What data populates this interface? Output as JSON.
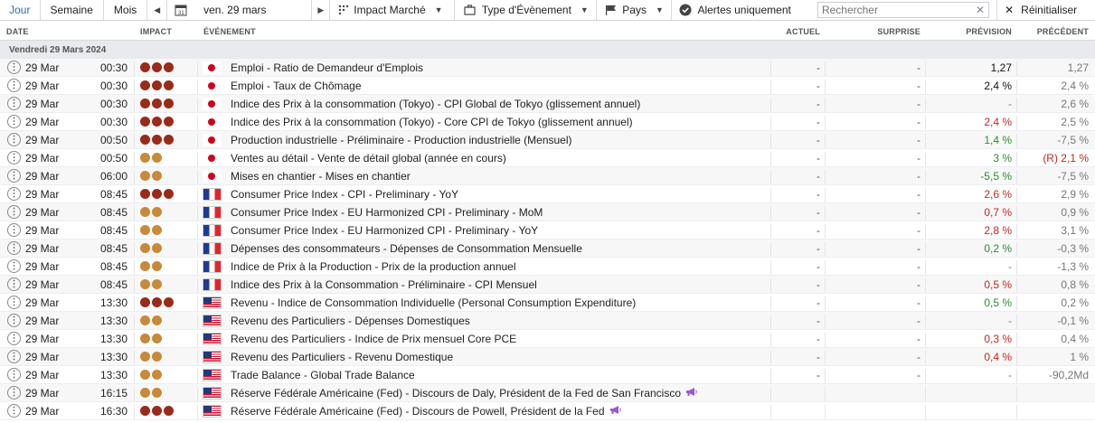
{
  "toolbar": {
    "tabs": [
      "Jour",
      "Semaine",
      "Mois"
    ],
    "date": "ven. 29 mars",
    "impact_filter": "Impact Marché",
    "type_filter": "Type d'Évènement",
    "country_filter": "Pays",
    "alerts_label": "Alertes uniquement",
    "search_placeholder": "Rechercher",
    "reset_label": "Réinitialiser"
  },
  "columns": {
    "date": "DATE",
    "impact": "IMPACT",
    "event": "ÉVÉNEMENT",
    "actual": "ACTUEL",
    "surprise": "SURPRISE",
    "forecast": "PRÉVISION",
    "previous": "PRÉCÉDENT"
  },
  "date_header": "Vendredi 29 Mars 2024",
  "rows": [
    {
      "date": "29 Mar",
      "time": "00:30",
      "impact": 3,
      "flag": "jp",
      "event": "Emploi - Ratio de Demandeur d'Emplois",
      "actual": "-",
      "surprise": "-",
      "forecast": "1,27",
      "forecast_trend": "neutral",
      "previous": "1,27"
    },
    {
      "date": "29 Mar",
      "time": "00:30",
      "impact": 3,
      "flag": "jp",
      "event": "Emploi - Taux de Chômage",
      "actual": "-",
      "surprise": "-",
      "forecast": "2,4 %",
      "forecast_trend": "neutral",
      "previous": "2,4 %"
    },
    {
      "date": "29 Mar",
      "time": "00:30",
      "impact": 3,
      "flag": "jp",
      "event": "Indice des Prix à la consommation (Tokyo) - CPI Global de Tokyo (glissement annuel)",
      "actual": "-",
      "surprise": "-",
      "forecast": "-",
      "forecast_trend": "none",
      "previous": "2,6 %"
    },
    {
      "date": "29 Mar",
      "time": "00:30",
      "impact": 3,
      "flag": "jp",
      "event": "Indice des Prix à la consommation (Tokyo) - Core CPI de Tokyo (glissement annuel)",
      "actual": "-",
      "surprise": "-",
      "forecast": "2,4 %",
      "forecast_trend": "down",
      "previous": "2,5 %"
    },
    {
      "date": "29 Mar",
      "time": "00:50",
      "impact": 3,
      "flag": "jp",
      "event": "Production industrielle - Préliminaire - Production industrielle (Mensuel)",
      "actual": "-",
      "surprise": "-",
      "forecast": "1,4 %",
      "forecast_trend": "up",
      "previous": "-7,5 %"
    },
    {
      "date": "29 Mar",
      "time": "00:50",
      "impact": 2,
      "flag": "jp",
      "event": "Ventes au détail - Vente de détail global (année en cours)",
      "actual": "-",
      "surprise": "-",
      "forecast": "3 %",
      "forecast_trend": "up",
      "previous": "(R) 2,1 %",
      "previous_trend": "down"
    },
    {
      "date": "29 Mar",
      "time": "06:00",
      "impact": 2,
      "flag": "jp",
      "event": "Mises en chantier - Mises en chantier",
      "actual": "-",
      "surprise": "-",
      "forecast": "-5,5 %",
      "forecast_trend": "up",
      "previous": "-7,5 %"
    },
    {
      "date": "29 Mar",
      "time": "08:45",
      "impact": 3,
      "flag": "fr",
      "event": "Consumer Price Index - CPI - Preliminary - YoY",
      "actual": "-",
      "surprise": "-",
      "forecast": "2,6 %",
      "forecast_trend": "down",
      "previous": "2,9 %"
    },
    {
      "date": "29 Mar",
      "time": "08:45",
      "impact": 2,
      "flag": "fr",
      "event": "Consumer Price Index - EU Harmonized CPI - Preliminary - MoM",
      "actual": "-",
      "surprise": "-",
      "forecast": "0,7 %",
      "forecast_trend": "down",
      "previous": "0,9 %"
    },
    {
      "date": "29 Mar",
      "time": "08:45",
      "impact": 2,
      "flag": "fr",
      "event": "Consumer Price Index - EU Harmonized CPI - Preliminary - YoY",
      "actual": "-",
      "surprise": "-",
      "forecast": "2,8 %",
      "forecast_trend": "down",
      "previous": "3,1 %"
    },
    {
      "date": "29 Mar",
      "time": "08:45",
      "impact": 2,
      "flag": "fr",
      "event": "Dépenses des consommateurs - Dépenses de Consommation Mensuelle",
      "actual": "-",
      "surprise": "-",
      "forecast": "0,2 %",
      "forecast_trend": "up",
      "previous": "-0,3 %"
    },
    {
      "date": "29 Mar",
      "time": "08:45",
      "impact": 2,
      "flag": "fr",
      "event": "Indice de Prix à la Production - Prix de la production annuel",
      "actual": "-",
      "surprise": "-",
      "forecast": "-",
      "forecast_trend": "none",
      "previous": "-1,3 %"
    },
    {
      "date": "29 Mar",
      "time": "08:45",
      "impact": 2,
      "flag": "fr",
      "event": "Indice des Prix à la Consommation - Préliminaire - CPI Mensuel",
      "actual": "-",
      "surprise": "-",
      "forecast": "0,5 %",
      "forecast_trend": "down",
      "previous": "0,8 %"
    },
    {
      "date": "29 Mar",
      "time": "13:30",
      "impact": 3,
      "flag": "us",
      "event": "Revenu - Indice de Consommation Individuelle (Personal Consumption Expenditure)",
      "actual": "-",
      "surprise": "-",
      "forecast": "0,5 %",
      "forecast_trend": "up",
      "previous": "0,2 %"
    },
    {
      "date": "29 Mar",
      "time": "13:30",
      "impact": 2,
      "flag": "us",
      "event": "Revenu des Particuliers - Dépenses Domestiques",
      "actual": "-",
      "surprise": "-",
      "forecast": "-",
      "forecast_trend": "none",
      "previous": "-0,1 %"
    },
    {
      "date": "29 Mar",
      "time": "13:30",
      "impact": 2,
      "flag": "us",
      "event": "Revenu des Particuliers - Indice de Prix mensuel Core PCE",
      "actual": "-",
      "surprise": "-",
      "forecast": "0,3 %",
      "forecast_trend": "down",
      "previous": "0,4 %"
    },
    {
      "date": "29 Mar",
      "time": "13:30",
      "impact": 2,
      "flag": "us",
      "event": "Revenu des Particuliers - Revenu Domestique",
      "actual": "-",
      "surprise": "-",
      "forecast": "0,4 %",
      "forecast_trend": "down",
      "previous": "1 %"
    },
    {
      "date": "29 Mar",
      "time": "13:30",
      "impact": 2,
      "flag": "us",
      "event": "Trade Balance - Global Trade Balance",
      "actual": "-",
      "surprise": "-",
      "forecast": "-",
      "forecast_trend": "none",
      "previous": "-90,2Md"
    },
    {
      "date": "29 Mar",
      "time": "16:15",
      "impact": 2,
      "flag": "us",
      "event": "Réserve Fédérale Américaine (Fed) - Discours de Daly, Président de la Fed de San Francisco",
      "actual": "",
      "surprise": "",
      "forecast": "",
      "forecast_trend": "none",
      "previous": "",
      "speech": true
    },
    {
      "date": "29 Mar",
      "time": "16:30",
      "impact": 3,
      "flag": "us",
      "event": "Réserve Fédérale Américaine (Fed) - Discours de Powell, Président de la Fed",
      "actual": "",
      "surprise": "",
      "forecast": "",
      "forecast_trend": "none",
      "previous": "",
      "speech": true
    }
  ]
}
